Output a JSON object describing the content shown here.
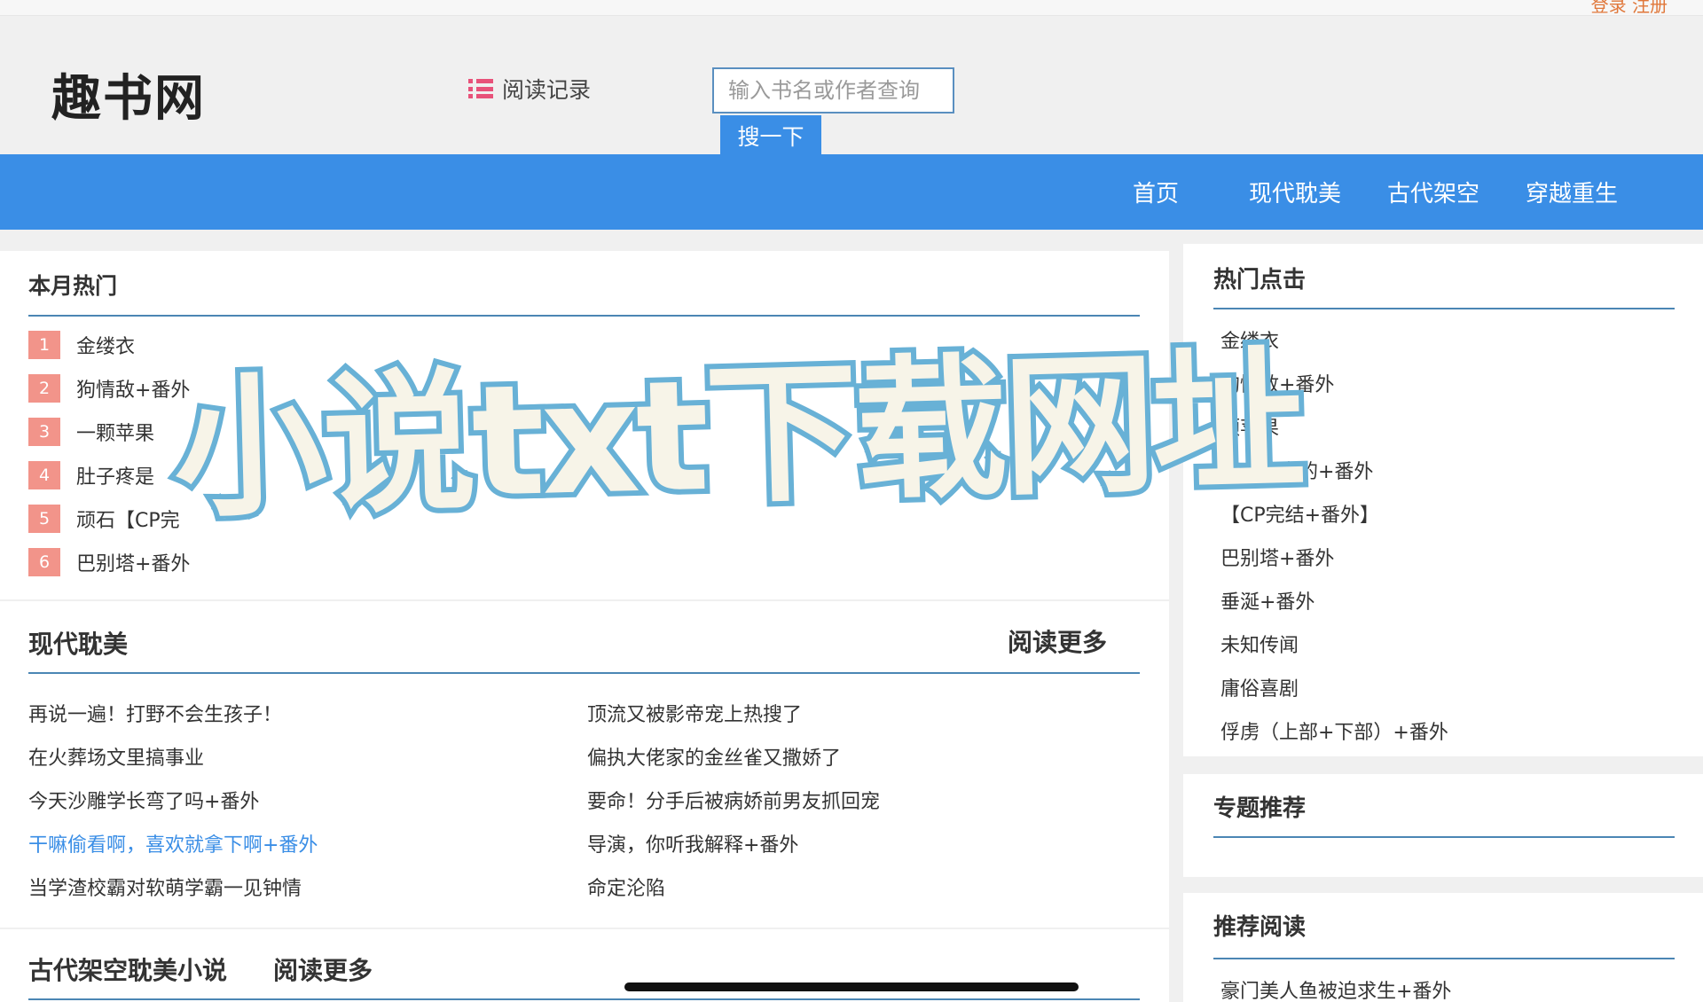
{
  "top": {
    "auth_links": "登录 注册"
  },
  "header": {
    "logo": "趣书网",
    "history_label": "阅读记录",
    "search_placeholder": "输入书名或作者查询",
    "search_button": "搜一下"
  },
  "nav": [
    "首页",
    "现代耽美",
    "古代架空",
    "穿越重生"
  ],
  "monthly_hot": {
    "title": "本月热门",
    "items": [
      {
        "rank": "1",
        "name": "金缕衣"
      },
      {
        "rank": "2",
        "name": "狗情敌+番外"
      },
      {
        "rank": "3",
        "name": "一颗苹果"
      },
      {
        "rank": "4",
        "name": "肚子疼是"
      },
      {
        "rank": "5",
        "name": "顽石【CP完"
      },
      {
        "rank": "6",
        "name": "巴别塔+番外"
      }
    ]
  },
  "modern": {
    "title": "现代耽美",
    "more": "阅读更多",
    "left": [
      "再说一遍！打野不会生孩子！",
      "在火葬场文里搞事业",
      "今天沙雕学长弯了吗+番外",
      "干嘛偷看啊，喜欢就拿下啊+番外",
      "当学渣校霸对软萌学霸一见钟情"
    ],
    "right": [
      "顶流又被影帝宠上热搜了",
      "偏执大佬家的金丝雀又撒娇了",
      "要命！分手后被病娇前男友抓回宠",
      "导演，你听我解释+番外",
      "命定沦陷"
    ]
  },
  "ancient": {
    "title": "古代架空耽美小说",
    "more": "阅读更多"
  },
  "hot_clicks": {
    "title": "热门点击",
    "items": [
      "金缕衣",
      "狗情敌+番外",
      "颗苹果",
      "子疼是真的+番外",
      "【CP完结+番外】",
      "巴别塔+番外",
      "垂涎+番外",
      "未知传闻",
      "庸俗喜剧",
      "俘虏（上部+下部）+番外"
    ]
  },
  "topics": {
    "title": "专题推荐"
  },
  "recommend": {
    "title": "推荐阅读",
    "items": [
      "豪门美人鱼被迫求生+番外"
    ]
  },
  "overlay_text": "小说txt下载网址"
}
